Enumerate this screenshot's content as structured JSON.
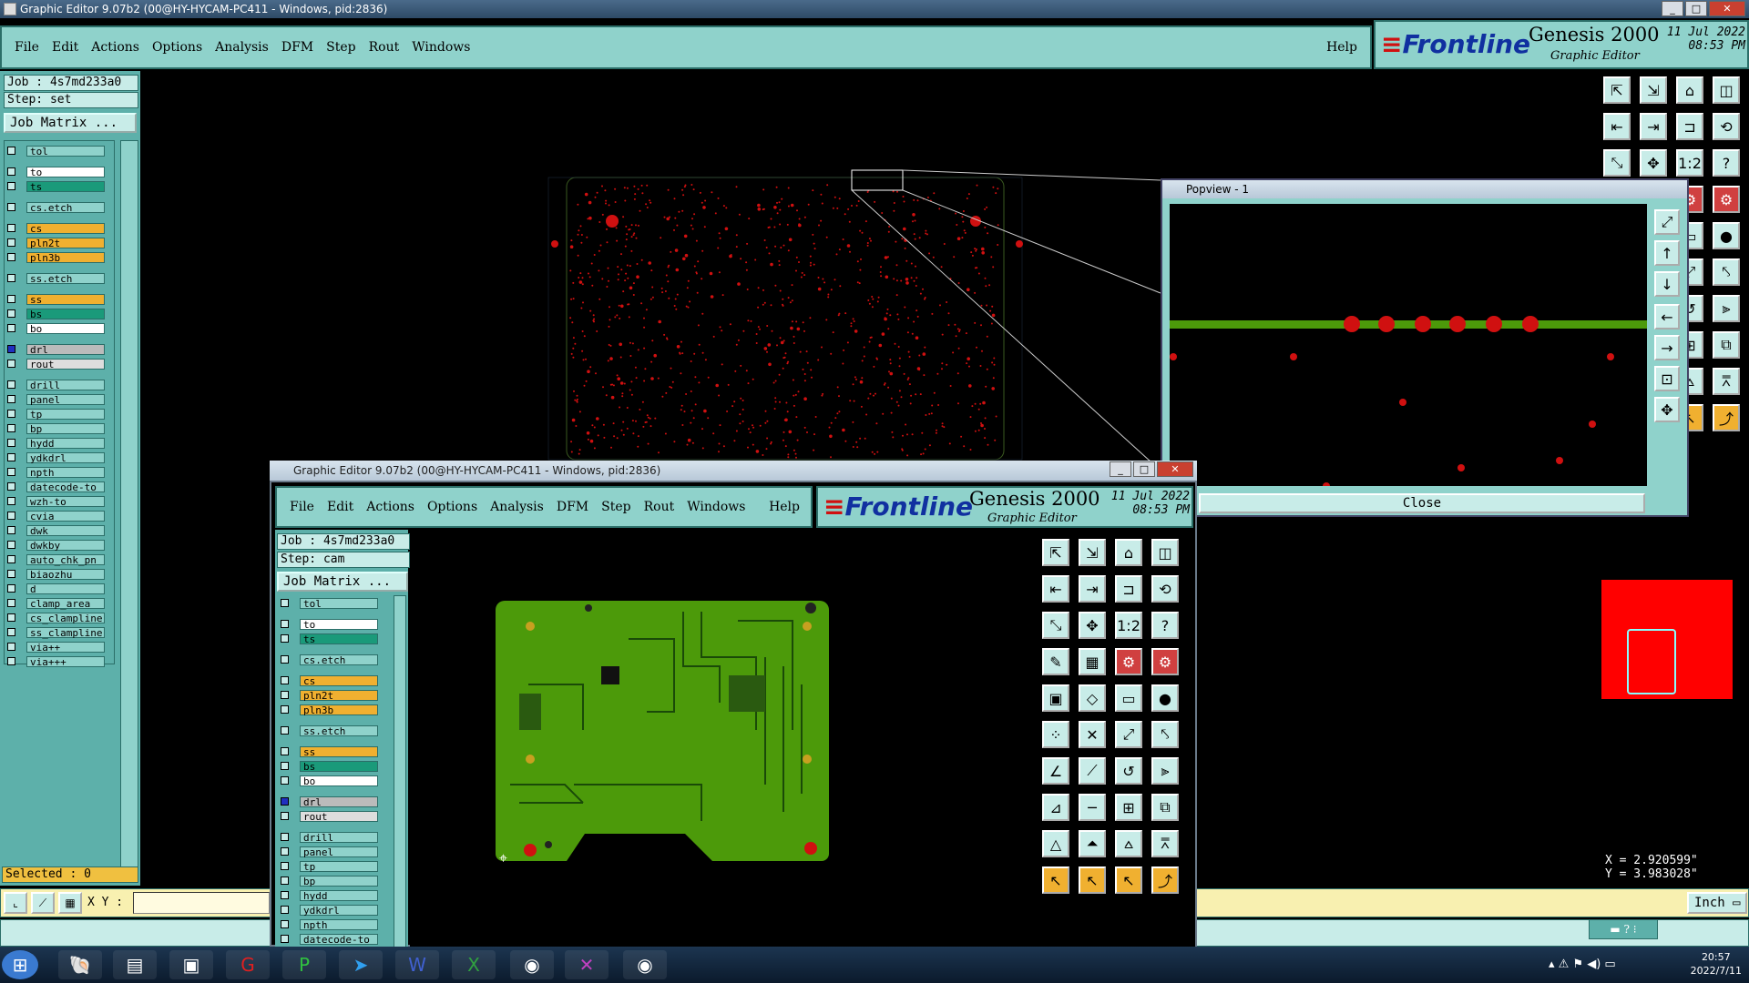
{
  "main_window": {
    "title": "Graphic Editor 9.07b2 (00@HY-HYCAM-PC411 - Windows, pid:2836)",
    "menu": [
      "File",
      "Edit",
      "Actions",
      "Options",
      "Analysis",
      "DFM",
      "Step",
      "Rout",
      "Windows"
    ],
    "help": "Help",
    "brand": {
      "logo": "Frontline",
      "product": "Genesis 2000",
      "subtitle": "Graphic Editor",
      "date": "11 Jul 2022",
      "time": "08:53 PM"
    },
    "job": "Job : 4s7md233a0",
    "step": "Step: set",
    "job_matrix": "Job Matrix ...",
    "selected": "Selected : 0",
    "xy_label": "X Y :",
    "units": "Inch",
    "coords": {
      "x": "X = 2.920599\"",
      "y": "Y = 3.983028\""
    },
    "layers": [
      "tol",
      "to",
      "ts",
      "cs.etch",
      "cs",
      "pln2t",
      "pln3b",
      "ss.etch",
      "ss",
      "bs",
      "bo",
      "drl",
      "rout",
      "drill",
      "panel",
      "tp",
      "bp",
      "hydd",
      "ydkdrl",
      "npth",
      "datecode-to",
      "wzh-to",
      "cvia",
      "dwk",
      "dwkby",
      "auto_chk_pn",
      "biaozhu",
      "d",
      "clamp_area",
      "cs_clampline",
      "ss_clampline",
      "via++",
      "via+++"
    ]
  },
  "popview": {
    "title": "Popview - 1",
    "close": "Close"
  },
  "sub_window": {
    "title": "Graphic Editor 9.07b2 (00@HY-HYCAM-PC411 - Windows, pid:2836)",
    "menu": [
      "File",
      "Edit",
      "Actions",
      "Options",
      "Analysis",
      "DFM",
      "Step",
      "Rout",
      "Windows"
    ],
    "help": "Help",
    "brand": {
      "logo": "Frontline",
      "product": "Genesis 2000",
      "subtitle": "Graphic Editor",
      "date": "11 Jul 2022",
      "time": "08:53 PM"
    },
    "job": "Job : 4s7md233a0",
    "step": "Step: cam",
    "job_matrix": "Job Matrix ...",
    "layers": [
      "tol",
      "to",
      "ts",
      "cs.etch",
      "cs",
      "pln2t",
      "pln3b",
      "ss.etch",
      "ss",
      "bs",
      "bo",
      "drl",
      "rout",
      "drill",
      "panel",
      "tp",
      "bp",
      "hydd",
      "ydkdrl",
      "npth",
      "datecode-to"
    ]
  },
  "taskbar": {
    "time": "20:57",
    "date": "2022/7/11"
  },
  "colors": {
    "panel": "#8fd2cb",
    "dark_panel": "#5db0aa",
    "green_layer": "#1a9a7a",
    "yellow_layer": "#f0b030",
    "board": "#4c9a0a"
  }
}
